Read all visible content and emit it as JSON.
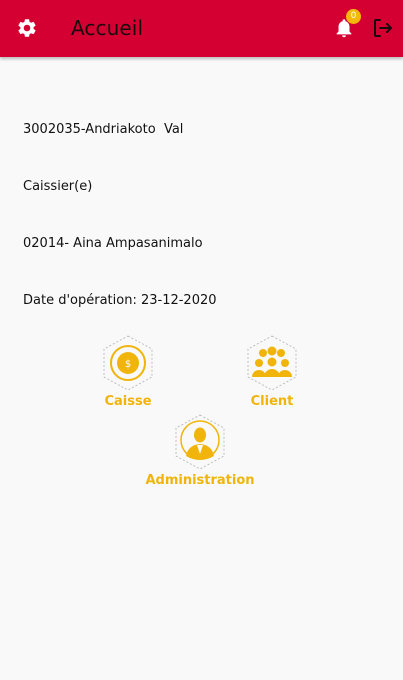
{
  "header": {
    "title": "Accueil",
    "notification_count": "0",
    "icons": {
      "settings": "gear-icon",
      "notifications": "bell-icon",
      "logout": "logout-icon"
    }
  },
  "info": {
    "line1": "3002035-Andriakoto  Val",
    "line2": "Caissier(e)",
    "line3": "02014- Aina Ampasanimalo",
    "line4": "Date d'opération: 23-12-2020"
  },
  "menu": {
    "caisse": {
      "label": "Caisse",
      "icon": "cash-register-icon"
    },
    "client": {
      "label": "Client",
      "icon": "client-group-icon"
    },
    "administration": {
      "label": "Administration",
      "icon": "administrator-icon"
    }
  },
  "colors": {
    "primary": "#d50032",
    "accent": "#f0b40b",
    "background": "#f9f9f9"
  }
}
